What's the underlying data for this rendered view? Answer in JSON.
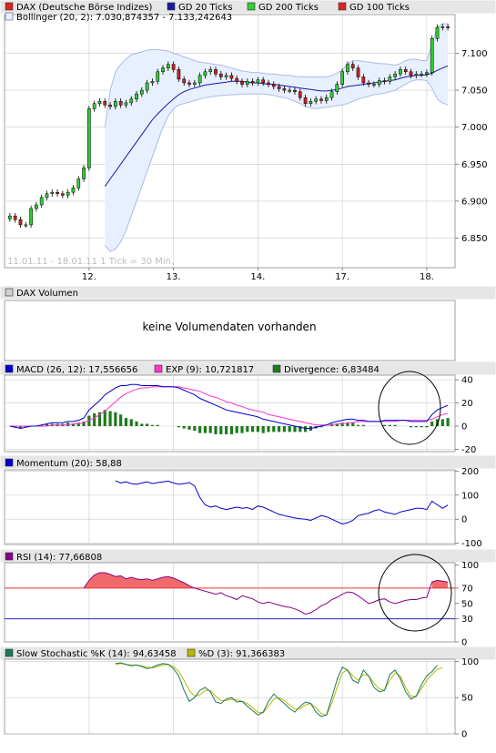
{
  "colors": {
    "up": "#33cc33",
    "down": "#cc2222",
    "gd20": "#1a1aa8",
    "band_fill": "#e8efff",
    "band_line": "#a9bde8",
    "macd": "#0000cc",
    "exp": "#ff33cc",
    "divergence": "#1e7a1e",
    "momentum": "#0000cc",
    "rsi_line": "#880088",
    "rsi_fill": "#f06a6a",
    "rsi70": "#ee3333",
    "rsi30": "#2222cc",
    "stoch_k": "#1a7a5a",
    "stoch_d": "#b8b800",
    "grid": "#cccccc",
    "header_bg": "#e6e6e6",
    "circle": "#000000"
  },
  "chart_data": [
    {
      "type": "candlestick",
      "legend": [
        {
          "label": "DAX (Deutsche Börse Indizes)",
          "color": "#dd2222"
        },
        {
          "label": "GD 20 Ticks",
          "color": "#1a1aa8"
        },
        {
          "label": "GD 200 Ticks",
          "color": "#33cc33"
        },
        {
          "label": "GD 100 Ticks",
          "color": "#dd2222"
        }
      ],
      "bollinger_label": "Bollinger (20, 2): 7.030,874357 - 7.133,242643",
      "watermark": "11.01.11 - 18.01.11   1 Tick = 30 Min.",
      "x_ticks": [
        {
          "i": 15,
          "label": "12."
        },
        {
          "i": 31,
          "label": "13."
        },
        {
          "i": 47,
          "label": "14."
        },
        {
          "i": 63,
          "label": "17."
        },
        {
          "i": 79,
          "label": "18."
        }
      ],
      "y_ticks": [
        6850,
        6900,
        6950,
        7000,
        7050,
        7100
      ],
      "y_tick_labels": [
        "6.850",
        "6.900",
        "6.950",
        "7.000",
        "7.050",
        "7.100"
      ],
      "ylim": [
        6810,
        7140
      ],
      "close": [
        6880,
        6875,
        6868,
        6868,
        6890,
        6895,
        6905,
        6910,
        6912,
        6910,
        6908,
        6912,
        6918,
        6930,
        6945,
        7025,
        7032,
        7035,
        7030,
        7028,
        7035,
        7030,
        7033,
        7038,
        7045,
        7050,
        7060,
        7062,
        7075,
        7080,
        7085,
        7078,
        7065,
        7060,
        7058,
        7060,
        7070,
        7075,
        7078,
        7072,
        7068,
        7070,
        7066,
        7062,
        7058,
        7062,
        7060,
        7064,
        7060,
        7058,
        7055,
        7052,
        7050,
        7050,
        7048,
        7040,
        7032,
        7035,
        7038,
        7036,
        7040,
        7048,
        7058,
        7075,
        7085,
        7080,
        7068,
        7060,
        7058,
        7058,
        7063,
        7062,
        7068,
        7072,
        7078,
        7075,
        7070,
        7072,
        7072,
        7074,
        7120,
        7135,
        7136,
        7135
      ],
      "bb_upper": [
        null,
        null,
        null,
        null,
        null,
        null,
        null,
        null,
        null,
        null,
        null,
        null,
        null,
        null,
        null,
        null,
        null,
        null,
        7000,
        7050,
        7075,
        7085,
        7092,
        7098,
        7100,
        7102,
        7104,
        7105,
        7105,
        7104,
        7103,
        7100,
        7098,
        7095,
        7093,
        7090,
        7088,
        7087,
        7086,
        7085,
        7084,
        7082,
        7080,
        7078,
        7076,
        7075,
        7074,
        7074,
        7073,
        7072,
        7072,
        7071,
        7070,
        7070,
        7069,
        7068,
        7068,
        7068,
        7068,
        7068,
        7068,
        7070,
        7073,
        7078,
        7085,
        7090,
        7090,
        7089,
        7088,
        7087,
        7086,
        7086,
        7085,
        7084,
        7086,
        7090,
        7092,
        7092,
        7090,
        7090,
        7112,
        7135,
        7140,
        7140
      ],
      "bb_lower": [
        null,
        null,
        null,
        null,
        null,
        null,
        null,
        null,
        null,
        null,
        null,
        null,
        null,
        null,
        null,
        null,
        null,
        null,
        6840,
        6832,
        6835,
        6845,
        6860,
        6880,
        6900,
        6920,
        6940,
        6960,
        6980,
        7000,
        7015,
        7025,
        7030,
        7032,
        7034,
        7036,
        7038,
        7040,
        7041,
        7042,
        7043,
        7043,
        7044,
        7044,
        7045,
        7045,
        7045,
        7045,
        7045,
        7044,
        7043,
        7041,
        7040,
        7038,
        7035,
        7032,
        7028,
        7026,
        7025,
        7026,
        7027,
        7028,
        7029,
        7030,
        7032,
        7035,
        7038,
        7040,
        7042,
        7044,
        7045,
        7046,
        7048,
        7050,
        7054,
        7058,
        7062,
        7064,
        7064,
        7063,
        7053,
        7038,
        7033,
        7030
      ],
      "gd20": [
        null,
        null,
        null,
        null,
        null,
        null,
        null,
        null,
        null,
        null,
        null,
        null,
        null,
        null,
        null,
        null,
        null,
        null,
        6920,
        6930,
        6940,
        6950,
        6960,
        6970,
        6980,
        6990,
        7000,
        7010,
        7018,
        7025,
        7032,
        7038,
        7044,
        7048,
        7051,
        7053,
        7055,
        7057,
        7058,
        7059,
        7060,
        7061,
        7062,
        7062,
        7062,
        7061,
        7060,
        7060,
        7059,
        7058,
        7058,
        7057,
        7056,
        7055,
        7054,
        7053,
        7052,
        7051,
        7050,
        7049,
        7049,
        7050,
        7051,
        7053,
        7055,
        7056,
        7057,
        7058,
        7059,
        7060,
        7061,
        7062,
        7063,
        7064,
        7066,
        7068,
        7069,
        7070,
        7070,
        7071,
        7073,
        7077,
        7080,
        7083
      ]
    },
    {
      "type": "bar",
      "title": "DAX Volumen",
      "message": "keine Volumendaten vorhanden"
    },
    {
      "type": "line",
      "legend": [
        {
          "label": "MACD (26, 12): 17,556656",
          "color": "#0000cc"
        },
        {
          "label": "EXP (9): 10,721817",
          "color": "#ff33cc"
        },
        {
          "label": "Divergence: 6,83484",
          "color": "#1e7a1e"
        }
      ],
      "y_ticks": [
        40,
        20,
        0,
        -20
      ],
      "y_tick_labels": [
        "40",
        "20",
        "0",
        "-20"
      ],
      "ylim": [
        -22,
        44
      ],
      "macd": [
        0,
        -1,
        -2,
        -1,
        0,
        0,
        1,
        2,
        3,
        3,
        3,
        4,
        4,
        5,
        7,
        14,
        18,
        22,
        27,
        30,
        33,
        35,
        35,
        36,
        36,
        35,
        35,
        35,
        35,
        34,
        34,
        34,
        33,
        31,
        29,
        27,
        24,
        22,
        20,
        18,
        16,
        14,
        13,
        12,
        11,
        10,
        9,
        8,
        6,
        5,
        4,
        3,
        2,
        1,
        0,
        -1,
        -2,
        -2,
        -1,
        0,
        1,
        3,
        4,
        5,
        6,
        6,
        5,
        5,
        4,
        4,
        4,
        5,
        5,
        5,
        5,
        5,
        4,
        4,
        4,
        4,
        10,
        14,
        16,
        18
      ],
      "exp": [
        0,
        0,
        0,
        0,
        0,
        0,
        0,
        0,
        1,
        1,
        1,
        1,
        2,
        2,
        3,
        5,
        7,
        10,
        13,
        17,
        21,
        25,
        28,
        30,
        32,
        33,
        33,
        34,
        34,
        34,
        34,
        34,
        34,
        33,
        32,
        31,
        30,
        28,
        26,
        25,
        23,
        21,
        20,
        18,
        17,
        15,
        14,
        13,
        12,
        10,
        9,
        8,
        7,
        6,
        5,
        4,
        3,
        2,
        1,
        1,
        1,
        1,
        2,
        2,
        3,
        3,
        4,
        4,
        4,
        4,
        4,
        4,
        4,
        4,
        5,
        5,
        5,
        5,
        5,
        5,
        6,
        8,
        10,
        11
      ],
      "divergence": [
        0,
        -1,
        -2,
        -1,
        0,
        0,
        1,
        2,
        2,
        2,
        2,
        3,
        2,
        3,
        4,
        9,
        11,
        12,
        14,
        13,
        12,
        10,
        7,
        6,
        4,
        2,
        2,
        1,
        1,
        0,
        0,
        0,
        -1,
        -2,
        -3,
        -4,
        -6,
        -6,
        -6,
        -7,
        -7,
        -7,
        -7,
        -6,
        -6,
        -5,
        -5,
        -5,
        -6,
        -5,
        -5,
        -5,
        -5,
        -5,
        -5,
        -5,
        -5,
        -4,
        -2,
        -1,
        0,
        2,
        2,
        3,
        3,
        3,
        1,
        1,
        0,
        0,
        0,
        1,
        1,
        1,
        0,
        0,
        -1,
        -1,
        -1,
        -1,
        4,
        6,
        6,
        7
      ]
    },
    {
      "type": "line",
      "legend": [
        {
          "label": "Momentum (20): 58,88",
          "color": "#0000cc"
        }
      ],
      "y_ticks": [
        200,
        100,
        0,
        -100
      ],
      "y_tick_labels": [
        "200",
        "100",
        "0",
        "-100"
      ],
      "ylim": [
        -105,
        205
      ],
      "momentum": [
        null,
        null,
        null,
        null,
        null,
        null,
        null,
        null,
        null,
        null,
        null,
        null,
        null,
        null,
        null,
        null,
        null,
        null,
        null,
        null,
        160,
        150,
        155,
        148,
        145,
        150,
        155,
        148,
        152,
        155,
        158,
        150,
        145,
        148,
        152,
        138,
        90,
        60,
        50,
        55,
        45,
        40,
        45,
        50,
        45,
        48,
        40,
        55,
        50,
        40,
        30,
        20,
        15,
        10,
        5,
        2,
        0,
        -5,
        5,
        15,
        10,
        0,
        -10,
        -20,
        -15,
        -5,
        15,
        20,
        25,
        35,
        40,
        30,
        25,
        20,
        30,
        35,
        40,
        45,
        45,
        40,
        75,
        60,
        45,
        58.88
      ]
    },
    {
      "type": "line",
      "legend": [
        {
          "label": "RSI (14): 77,66808",
          "color": "#880088"
        }
      ],
      "y_ticks": [
        100,
        70,
        50,
        30,
        0
      ],
      "y_tick_labels": [
        "100",
        "70",
        "50",
        "30",
        "0"
      ],
      "ylim": [
        0,
        103
      ],
      "reference_lines": [
        70,
        30
      ],
      "rsi": [
        null,
        null,
        null,
        null,
        null,
        null,
        null,
        null,
        null,
        null,
        null,
        null,
        null,
        null,
        70,
        80,
        87,
        90,
        90,
        88,
        85,
        86,
        82,
        84,
        82,
        81,
        82,
        80,
        82,
        84,
        85,
        83,
        80,
        77,
        73,
        70,
        68,
        66,
        64,
        62,
        64,
        60,
        58,
        55,
        60,
        58,
        56,
        52,
        50,
        52,
        50,
        48,
        46,
        45,
        43,
        40,
        36,
        38,
        42,
        47,
        50,
        55,
        58,
        62,
        65,
        64,
        60,
        55,
        50,
        52,
        55,
        56,
        52,
        50,
        52,
        54,
        55,
        55,
        57,
        58,
        78,
        80,
        79,
        77.67
      ]
    },
    {
      "type": "line",
      "legend": [
        {
          "label": "Slow Stochastic %K (14): 94,63458",
          "color": "#1a7a5a"
        },
        {
          "label": "%D (3): 91,366383",
          "color": "#b8b800"
        }
      ],
      "y_ticks": [
        100,
        50,
        0
      ],
      "y_tick_labels": [
        "100",
        "50",
        "0"
      ],
      "ylim": [
        0,
        103
      ],
      "k": [
        null,
        null,
        null,
        null,
        null,
        null,
        null,
        null,
        null,
        null,
        null,
        null,
        null,
        null,
        null,
        null,
        null,
        null,
        null,
        null,
        97,
        98,
        96,
        94,
        95,
        93,
        90,
        92,
        95,
        97,
        96,
        90,
        80,
        60,
        45,
        50,
        60,
        64,
        58,
        44,
        42,
        48,
        50,
        44,
        45,
        38,
        32,
        26,
        30,
        45,
        55,
        48,
        42,
        35,
        30,
        38,
        44,
        42,
        30,
        24,
        26,
        50,
        75,
        92,
        88,
        74,
        70,
        88,
        80,
        64,
        58,
        60,
        82,
        88,
        76,
        58,
        48,
        52,
        68,
        80,
        86,
        94.63
      ],
      "d": [
        null,
        null,
        null,
        null,
        null,
        null,
        null,
        null,
        null,
        null,
        null,
        null,
        null,
        null,
        null,
        null,
        null,
        null,
        null,
        null,
        96,
        97,
        96,
        95,
        95,
        94,
        92,
        91,
        93,
        95,
        96,
        93,
        86,
        74,
        60,
        52,
        54,
        60,
        60,
        52,
        46,
        46,
        48,
        47,
        45,
        42,
        36,
        30,
        29,
        38,
        48,
        50,
        46,
        40,
        34,
        35,
        40,
        42,
        36,
        28,
        26,
        42,
        64,
        84,
        88,
        80,
        74,
        82,
        80,
        70,
        62,
        60,
        74,
        84,
        80,
        64,
        52,
        52,
        62,
        74,
        82,
        89,
        91.37
      ]
    }
  ]
}
